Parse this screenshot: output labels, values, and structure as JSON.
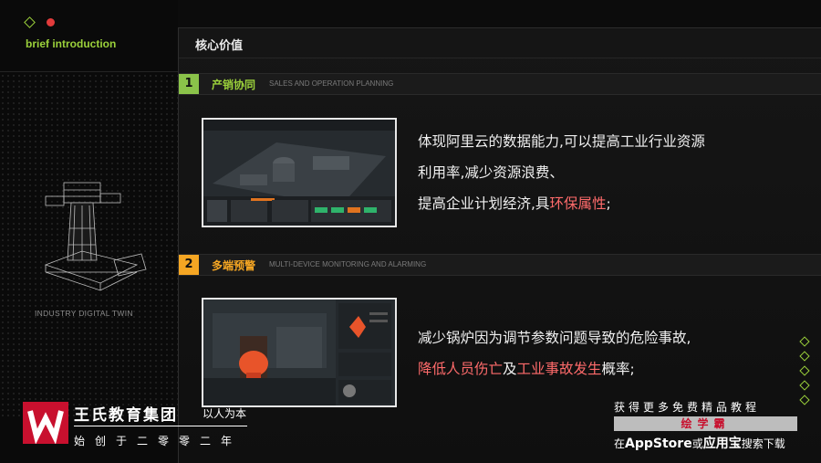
{
  "left": {
    "brief": "brief introduction",
    "industry_label": "INDUSTRY DIGITAL TWIN"
  },
  "main": {
    "title": "核心价值",
    "sections": [
      {
        "number": "1",
        "title": "产销协同",
        "subtitle": "SALES AND OPERATION PLANNING",
        "accent": "#8bc34a",
        "lines": [
          "体现阿里云的数据能力,可以提高工业行业资源",
          "利用率,减少资源浪费、"
        ],
        "line3_prefix": "提高企业计划经济,具",
        "line3_highlight": "环保属性",
        "line3_suffix": ";"
      },
      {
        "number": "2",
        "title": "多端预警",
        "subtitle": "MULTI-DEVICE MONITORING AND ALARMING",
        "accent": "#f5a623",
        "line1": "减少锅炉因为调节参数问题导致的危险事故,",
        "line2_hl1": "降低人员伤亡",
        "line2_mid": "及",
        "line2_hl2": "工业事故发生",
        "line2_suffix": "概率;"
      }
    ]
  },
  "watermark": {
    "brand": "王氏教育集团",
    "slogan": "以人为本",
    "since": "始创于二零零二年",
    "promo_top": "获得更多免费精品教程",
    "promo_name": "绘学霸",
    "promo_bottom_prefix": "在",
    "promo_bottom_app": "AppStore",
    "promo_bottom_mid": "或",
    "promo_bottom_app2": "应用宝",
    "promo_bottom_suffix": "搜索下载"
  },
  "colors": {
    "green": "#9bd13b",
    "orange": "#f5a623",
    "highlight": "#ff6b6b",
    "brand_red": "#c8102e"
  }
}
